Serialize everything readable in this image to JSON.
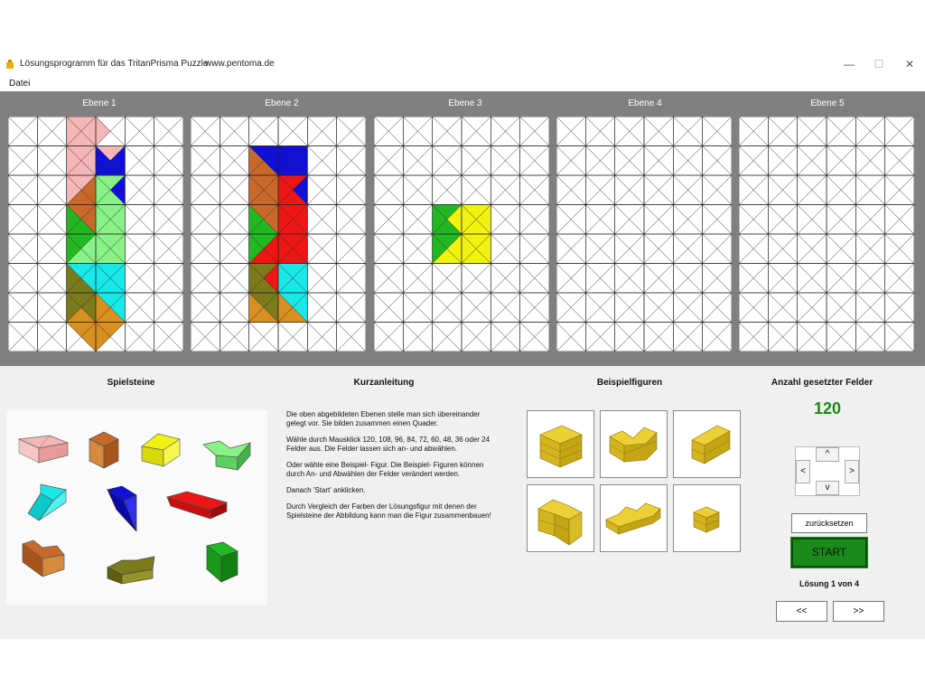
{
  "window": {
    "title": "Lösungsprogramm für das TritanPrisma Puzzle",
    "url": "www.pentoma.de",
    "minimize": "—",
    "maximize": "☐",
    "close": "✕"
  },
  "menu": {
    "file": "Datei"
  },
  "layers": [
    {
      "label": "Ebene 1",
      "fills": [
        {
          "r": 0,
          "c": 2,
          "t": "a",
          "col": "#f4b6b6"
        },
        {
          "r": 0,
          "c": 2,
          "t": "b",
          "col": "#f4b6b6"
        },
        {
          "r": 0,
          "c": 2,
          "t": "c",
          "col": "#f4b6b6"
        },
        {
          "r": 0,
          "c": 2,
          "t": "d",
          "col": "#f4b6b6"
        },
        {
          "r": 0,
          "c": 3,
          "t": "d",
          "col": "#f4b6b6"
        },
        {
          "r": 1,
          "c": 2,
          "t": "a",
          "col": "#f4b6b6"
        },
        {
          "r": 1,
          "c": 2,
          "t": "b",
          "col": "#f4b6b6"
        },
        {
          "r": 1,
          "c": 2,
          "t": "c",
          "col": "#f4b6b6"
        },
        {
          "r": 1,
          "c": 2,
          "t": "d",
          "col": "#f4b6b6"
        },
        {
          "r": 1,
          "c": 3,
          "t": "a",
          "col": "#f4b6b6"
        },
        {
          "r": 1,
          "c": 3,
          "t": "b",
          "col": "#1010d8"
        },
        {
          "r": 1,
          "c": 3,
          "t": "c",
          "col": "#1010d8"
        },
        {
          "r": 1,
          "c": 3,
          "t": "d",
          "col": "#1010d8"
        },
        {
          "r": 2,
          "c": 2,
          "t": "a",
          "col": "#f4b6b6"
        },
        {
          "r": 2,
          "c": 2,
          "t": "b",
          "col": "#c8692a"
        },
        {
          "r": 2,
          "c": 2,
          "t": "c",
          "col": "#c8692a"
        },
        {
          "r": 2,
          "c": 2,
          "t": "d",
          "col": "#f4b6b6"
        },
        {
          "r": 2,
          "c": 3,
          "t": "a",
          "col": "#88f288"
        },
        {
          "r": 2,
          "c": 3,
          "t": "b",
          "col": "#1010d8"
        },
        {
          "r": 2,
          "c": 3,
          "t": "c",
          "col": "#88f288"
        },
        {
          "r": 2,
          "c": 3,
          "t": "d",
          "col": "#88f288"
        },
        {
          "r": 3,
          "c": 2,
          "t": "a",
          "col": "#c8692a"
        },
        {
          "r": 3,
          "c": 2,
          "t": "b",
          "col": "#c8692a"
        },
        {
          "r": 3,
          "c": 2,
          "t": "c",
          "col": "#22b822"
        },
        {
          "r": 3,
          "c": 2,
          "t": "d",
          "col": "#22b822"
        },
        {
          "r": 3,
          "c": 3,
          "t": "a",
          "col": "#88f288"
        },
        {
          "r": 3,
          "c": 3,
          "t": "b",
          "col": "#88f288"
        },
        {
          "r": 3,
          "c": 3,
          "t": "c",
          "col": "#88f288"
        },
        {
          "r": 3,
          "c": 3,
          "t": "d",
          "col": "#88f288"
        },
        {
          "r": 4,
          "c": 2,
          "t": "a",
          "col": "#22b822"
        },
        {
          "r": 4,
          "c": 2,
          "t": "b",
          "col": "#88f288"
        },
        {
          "r": 4,
          "c": 2,
          "t": "c",
          "col": "#88f288"
        },
        {
          "r": 4,
          "c": 2,
          "t": "d",
          "col": "#22b822"
        },
        {
          "r": 4,
          "c": 3,
          "t": "a",
          "col": "#88f288"
        },
        {
          "r": 4,
          "c": 3,
          "t": "b",
          "col": "#88f288"
        },
        {
          "r": 4,
          "c": 3,
          "t": "c",
          "col": "#88f288"
        },
        {
          "r": 4,
          "c": 3,
          "t": "d",
          "col": "#88f288"
        },
        {
          "r": 5,
          "c": 2,
          "t": "a",
          "col": "#19e8e8"
        },
        {
          "r": 5,
          "c": 2,
          "t": "b",
          "col": "#19e8e8"
        },
        {
          "r": 5,
          "c": 2,
          "t": "c",
          "col": "#7b7b1c"
        },
        {
          "r": 5,
          "c": 2,
          "t": "d",
          "col": "#7b7b1c"
        },
        {
          "r": 5,
          "c": 3,
          "t": "a",
          "col": "#19e8e8"
        },
        {
          "r": 5,
          "c": 3,
          "t": "b",
          "col": "#19e8e8"
        },
        {
          "r": 5,
          "c": 3,
          "t": "c",
          "col": "#19e8e8"
        },
        {
          "r": 5,
          "c": 3,
          "t": "d",
          "col": "#19e8e8"
        },
        {
          "r": 6,
          "c": 2,
          "t": "a",
          "col": "#7b7b1c"
        },
        {
          "r": 6,
          "c": 2,
          "t": "b",
          "col": "#7b7b1c"
        },
        {
          "r": 6,
          "c": 2,
          "t": "c",
          "col": "#d89020"
        },
        {
          "r": 6,
          "c": 2,
          "t": "d",
          "col": "#7b7b1c"
        },
        {
          "r": 6,
          "c": 3,
          "t": "a",
          "col": "#19e8e8"
        },
        {
          "r": 6,
          "c": 3,
          "t": "b",
          "col": "#19e8e8"
        },
        {
          "r": 6,
          "c": 3,
          "t": "c",
          "col": "#d89020"
        },
        {
          "r": 6,
          "c": 3,
          "t": "d",
          "col": "#d89020"
        },
        {
          "r": 7,
          "c": 2,
          "t": "a",
          "col": "#d89020"
        },
        {
          "r": 7,
          "c": 2,
          "t": "b",
          "col": "#d89020"
        },
        {
          "r": 7,
          "c": 3,
          "t": "a",
          "col": "#d89020"
        },
        {
          "r": 7,
          "c": 3,
          "t": "d",
          "col": "#d89020"
        }
      ]
    },
    {
      "label": "Ebene 2",
      "fills": [
        {
          "r": 1,
          "c": 2,
          "t": "a",
          "col": "#1010d8"
        },
        {
          "r": 1,
          "c": 2,
          "t": "b",
          "col": "#1010d8"
        },
        {
          "r": 1,
          "c": 2,
          "t": "c",
          "col": "#c8692a"
        },
        {
          "r": 1,
          "c": 2,
          "t": "d",
          "col": "#c8692a"
        },
        {
          "r": 1,
          "c": 3,
          "t": "a",
          "col": "#1010d8"
        },
        {
          "r": 1,
          "c": 3,
          "t": "b",
          "col": "#1010d8"
        },
        {
          "r": 1,
          "c": 3,
          "t": "c",
          "col": "#1010d8"
        },
        {
          "r": 1,
          "c": 3,
          "t": "d",
          "col": "#1010d8"
        },
        {
          "r": 2,
          "c": 2,
          "t": "a",
          "col": "#c8692a"
        },
        {
          "r": 2,
          "c": 2,
          "t": "b",
          "col": "#c8692a"
        },
        {
          "r": 2,
          "c": 2,
          "t": "c",
          "col": "#c8692a"
        },
        {
          "r": 2,
          "c": 2,
          "t": "d",
          "col": "#c8692a"
        },
        {
          "r": 2,
          "c": 3,
          "t": "a",
          "col": "#ee1515"
        },
        {
          "r": 2,
          "c": 3,
          "t": "b",
          "col": "#1010d8"
        },
        {
          "r": 2,
          "c": 3,
          "t": "c",
          "col": "#ee1515"
        },
        {
          "r": 2,
          "c": 3,
          "t": "d",
          "col": "#ee1515"
        },
        {
          "r": 3,
          "c": 2,
          "t": "a",
          "col": "#c8692a"
        },
        {
          "r": 3,
          "c": 2,
          "t": "b",
          "col": "#c8692a"
        },
        {
          "r": 3,
          "c": 2,
          "t": "c",
          "col": "#22b822"
        },
        {
          "r": 3,
          "c": 2,
          "t": "d",
          "col": "#22b822"
        },
        {
          "r": 3,
          "c": 3,
          "t": "a",
          "col": "#ee1515"
        },
        {
          "r": 3,
          "c": 3,
          "t": "b",
          "col": "#ee1515"
        },
        {
          "r": 3,
          "c": 3,
          "t": "c",
          "col": "#ee1515"
        },
        {
          "r": 3,
          "c": 3,
          "t": "d",
          "col": "#ee1515"
        },
        {
          "r": 4,
          "c": 2,
          "t": "a",
          "col": "#22b822"
        },
        {
          "r": 4,
          "c": 2,
          "t": "b",
          "col": "#ee1515"
        },
        {
          "r": 4,
          "c": 2,
          "t": "c",
          "col": "#ee1515"
        },
        {
          "r": 4,
          "c": 2,
          "t": "d",
          "col": "#22b822"
        },
        {
          "r": 4,
          "c": 3,
          "t": "a",
          "col": "#ee1515"
        },
        {
          "r": 4,
          "c": 3,
          "t": "b",
          "col": "#ee1515"
        },
        {
          "r": 4,
          "c": 3,
          "t": "c",
          "col": "#ee1515"
        },
        {
          "r": 4,
          "c": 3,
          "t": "d",
          "col": "#ee1515"
        },
        {
          "r": 5,
          "c": 2,
          "t": "a",
          "col": "#7b7b1c"
        },
        {
          "r": 5,
          "c": 2,
          "t": "b",
          "col": "#ee1515"
        },
        {
          "r": 5,
          "c": 2,
          "t": "c",
          "col": "#7b7b1c"
        },
        {
          "r": 5,
          "c": 2,
          "t": "d",
          "col": "#7b7b1c"
        },
        {
          "r": 5,
          "c": 3,
          "t": "a",
          "col": "#19e8e8"
        },
        {
          "r": 5,
          "c": 3,
          "t": "b",
          "col": "#19e8e8"
        },
        {
          "r": 5,
          "c": 3,
          "t": "c",
          "col": "#19e8e8"
        },
        {
          "r": 5,
          "c": 3,
          "t": "d",
          "col": "#19e8e8"
        },
        {
          "r": 6,
          "c": 2,
          "t": "a",
          "col": "#7b7b1c"
        },
        {
          "r": 6,
          "c": 2,
          "t": "b",
          "col": "#7b7b1c"
        },
        {
          "r": 6,
          "c": 2,
          "t": "c",
          "col": "#d89020"
        },
        {
          "r": 6,
          "c": 2,
          "t": "d",
          "col": "#d89020"
        },
        {
          "r": 6,
          "c": 3,
          "t": "a",
          "col": "#19e8e8"
        },
        {
          "r": 6,
          "c": 3,
          "t": "b",
          "col": "#19e8e8"
        },
        {
          "r": 6,
          "c": 3,
          "t": "c",
          "col": "#d89020"
        },
        {
          "r": 6,
          "c": 3,
          "t": "d",
          "col": "#d89020"
        }
      ]
    },
    {
      "label": "Ebene 3",
      "fills": [
        {
          "r": 3,
          "c": 2,
          "t": "a",
          "col": "#22b822"
        },
        {
          "r": 3,
          "c": 2,
          "t": "b",
          "col": "#f2f211"
        },
        {
          "r": 3,
          "c": 2,
          "t": "c",
          "col": "#22b822"
        },
        {
          "r": 3,
          "c": 2,
          "t": "d",
          "col": "#22b822"
        },
        {
          "r": 3,
          "c": 3,
          "t": "a",
          "col": "#f2f211"
        },
        {
          "r": 3,
          "c": 3,
          "t": "b",
          "col": "#f2f211"
        },
        {
          "r": 3,
          "c": 3,
          "t": "c",
          "col": "#f2f211"
        },
        {
          "r": 3,
          "c": 3,
          "t": "d",
          "col": "#f2f211"
        },
        {
          "r": 4,
          "c": 2,
          "t": "a",
          "col": "#22b822"
        },
        {
          "r": 4,
          "c": 2,
          "t": "b",
          "col": "#f2f211"
        },
        {
          "r": 4,
          "c": 2,
          "t": "c",
          "col": "#f2f211"
        },
        {
          "r": 4,
          "c": 2,
          "t": "d",
          "col": "#22b822"
        },
        {
          "r": 4,
          "c": 3,
          "t": "a",
          "col": "#f2f211"
        },
        {
          "r": 4,
          "c": 3,
          "t": "b",
          "col": "#f2f211"
        },
        {
          "r": 4,
          "c": 3,
          "t": "c",
          "col": "#f2f211"
        },
        {
          "r": 4,
          "c": 3,
          "t": "d",
          "col": "#f2f211"
        }
      ]
    },
    {
      "label": "Ebene 4",
      "fills": []
    },
    {
      "label": "Ebene 5",
      "fills": []
    }
  ],
  "sections": {
    "pieces": "Spielsteine",
    "guide": "Kurzanleitung",
    "examples": "Beispielfiguren",
    "count_title": "Anzahl gesetzter Felder"
  },
  "pieces": [
    {
      "color": "#f4b6b6"
    },
    {
      "color": "#c8692a"
    },
    {
      "color": "#f2f211"
    },
    {
      "color": "#88f288"
    },
    {
      "color": "#19e8e8"
    },
    {
      "color": "#1010d8"
    },
    {
      "color": "#ee1515"
    },
    {
      "color": "#c8692a"
    },
    {
      "color": "#7b7b1c"
    },
    {
      "color": "#22b822"
    }
  ],
  "instructions": [
    "Die oben abgebildeten Ebenen stelle man sich übereinander gelegt vor. Sie bilden zusammen einen Quader.",
    "Wähle durch Mausklick 120, 108, 96, 84, 72, 60, 48, 36 oder 24 Felder aus. Die Felder lassen sich an- und abwählen.",
    "Oder wähle eine Beispiel- Figur. Die Beispiel- Figuren können durch An- und Abwählen der Felder verändert werden.",
    "Danach 'Start' anklicken.",
    "Durch Vergleich der Farben der Lösungsfigur mit denen der Spielsteine der Abbildung kann man die Figur zusammenbauen!"
  ],
  "examples_color": "#ecd036",
  "count": "120",
  "arrows": {
    "up": "^",
    "down": "v",
    "left": "<",
    "right": ">"
  },
  "buttons": {
    "reset": "zurücksetzen",
    "start": "START",
    "prev": "<<",
    "next": ">>"
  },
  "solution": "Lösung 1 von 4"
}
